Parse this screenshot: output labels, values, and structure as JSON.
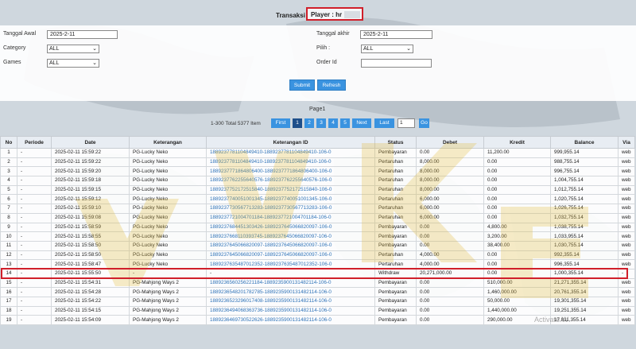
{
  "header": {
    "title": "Transaksi",
    "player_label": "Player : hr"
  },
  "filters": {
    "tanggal_awal_label": "Tanggal Awal",
    "tanggal_awal_value": "2025-2-11",
    "tanggal_akhir_label": "Tanggal akhir",
    "tanggal_akhir_value": "2025-2-11",
    "category_label": "Category",
    "category_value": "ALL",
    "pilih_label": "Pilih :",
    "pilih_value": "ALL",
    "games_label": "Games",
    "games_value": "ALL",
    "order_id_label": "Order Id",
    "order_id_value": "",
    "submit_label": "Submit",
    "refresh_label": "Refresh"
  },
  "pager": {
    "title": "Page1",
    "info": "1-300 Total 5377 Item",
    "first": "First",
    "pages": [
      "1",
      "2",
      "3",
      "4",
      "5"
    ],
    "next": "Next",
    "last": "Last",
    "input_value": "1",
    "go": "Go"
  },
  "table": {
    "columns": [
      "No",
      "Periode",
      "Date",
      "Keterangan",
      "Keterangan ID",
      "Status",
      "Debet",
      "Kredit",
      "Balance",
      "Via"
    ],
    "rows": [
      [
        "1",
        "-",
        "2025-02-11 15:59:22",
        "PG-Lucky Neko",
        "1889237781104849410-1889237781104849410-106-0",
        "Pembayaran",
        "0.00",
        "11,200.00",
        "999,955.14",
        "web"
      ],
      [
        "2",
        "-",
        "2025-02-11 15:59:22",
        "PG-Lucky Neko",
        "1889237781104849410-1889237781104849410-106-0",
        "Pertaruhan",
        "8,000.00",
        "0.00",
        "988,755.14",
        "web"
      ],
      [
        "3",
        "-",
        "2025-02-11 15:59:20",
        "PG-Lucky Neko",
        "1889237771864806400-1889237771864806400-106-0",
        "Pertaruhan",
        "8,000.00",
        "0.00",
        "996,755.14",
        "web"
      ],
      [
        "4",
        "-",
        "2025-02-11 15:59:18",
        "PG-Lucky Neko",
        "1889237762255640576-1889237762255640576-106-0",
        "Pertaruhan",
        "8,000.00",
        "0.00",
        "1,004,755.14",
        "web"
      ],
      [
        "5",
        "-",
        "2025-02-11 15:59:15",
        "PG-Lucky Neko",
        "1889237752172515840-1889237752172515840-106-0",
        "Pertaruhan",
        "8,000.00",
        "0.00",
        "1,012,755.14",
        "web"
      ],
      [
        "6",
        "-",
        "2025-02-11 15:59:12",
        "PG-Lucky Neko",
        "1889237740051001345-1889237740051001345-106-0",
        "Pertaruhan",
        "6,000.00",
        "0.00",
        "1,020,755.14",
        "web"
      ],
      [
        "7",
        "-",
        "2025-02-11 15:59:10",
        "PG-Lucky Neko",
        "1889237730567713283-1889237730567713283-106-0",
        "Pertaruhan",
        "6,000.00",
        "0.00",
        "1,026,755.14",
        "web"
      ],
      [
        "8",
        "-",
        "2025-02-11 15:59:08",
        "PG-Lucky Neko",
        "1889237721004701184-1889237721004701184-106-0",
        "Pertaruhan",
        "6,000.00",
        "0.00",
        "1,032,755.14",
        "web"
      ],
      [
        "9",
        "-",
        "2025-02-11 15:58:59",
        "PG-Lucky Neko",
        "1889237684451303426-1889237645066820097-106-0",
        "Pembayaran",
        "0.00",
        "4,800.00",
        "1,038,755.14",
        "web"
      ],
      [
        "10",
        "-",
        "2025-02-11 15:58:55",
        "PG-Lucky Neko",
        "1889237668110393745-1889237645066820097-106-0",
        "Pembayaran",
        "0.00",
        "3,200.00",
        "1,033,955.14",
        "web"
      ],
      [
        "11",
        "-",
        "2025-02-11 15:58:50",
        "PG-Lucky Neko",
        "1889237645066820097-1889237645066820097-106-0",
        "Pembayaran",
        "0.00",
        "38,400.00",
        "1,030,755.14",
        "web"
      ],
      [
        "12",
        "-",
        "2025-02-11 15:58:50",
        "PG-Lucky Neko",
        "1889237645066820097-1889237645066820097-106-0",
        "Pertaruhan",
        "4,000.00",
        "0.00",
        "992,355.14",
        "web"
      ],
      [
        "13",
        "-",
        "2025-02-11 15:58:47",
        "PG-Lucky Neko",
        "1889237635487012352-1889237635487012352-106-0",
        "Pertaruhan",
        "4,000.00",
        "0.00",
        "996,355.14",
        "web"
      ],
      [
        "14",
        "-",
        "2025-02-11 15:55:50",
        "-",
        "-",
        "Withdraw",
        "20,271,000.00",
        "0.00",
        "1,000,355.14",
        "-"
      ],
      [
        "15",
        "-",
        "2025-02-11 15:54:31",
        "PG-Mahjong Ways 2",
        "1889236560256221184-1889235900131482114-106-0",
        "Pembayaran",
        "0.00",
        "510,000.00",
        "21,271,355.14",
        "web"
      ],
      [
        "16",
        "-",
        "2025-02-11 15:54:28",
        "PG-Mahjong Ways 2",
        "1889236548201782785-1889235900131482114-106-0",
        "Pembayaran",
        "0.00",
        "1,460,000.00",
        "20,761,355.14",
        "web"
      ],
      [
        "17",
        "-",
        "2025-02-11 15:54:22",
        "PG-Mahjong Ways 2",
        "1889236523296017408-1889235900131482114-106-0",
        "Pembayaran",
        "0.00",
        "50,000.00",
        "19,301,355.14",
        "web"
      ],
      [
        "18",
        "-",
        "2025-02-11 15:54:15",
        "PG-Mahjong Ways 2",
        "1889236494068363736-1889235900131482114-106-0",
        "Pembayaran",
        "0.00",
        "1,440,000.00",
        "19,251,355.14",
        "web"
      ],
      [
        "19",
        "-",
        "2025-02-11 15:54:09",
        "PG-Mahjong Ways 2",
        "1889236469730522626-1889235900131482114-106-0",
        "Pembayaran",
        "0.00",
        "290,000.00",
        "17,811,355.14",
        "web"
      ]
    ]
  },
  "overlay": {
    "activate_text": "Activate W"
  },
  "colors": {
    "accent": "#3a93e0",
    "highlight": "#d01f2a",
    "link": "#2f73b8",
    "watermark": "#e2b93b"
  }
}
